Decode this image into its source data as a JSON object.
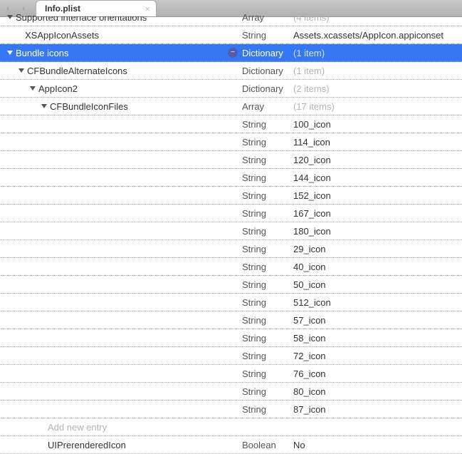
{
  "tab": {
    "title": "Info.plist"
  },
  "rows": [
    {
      "indent": 0,
      "disclosure": true,
      "key": "Supported interface orientations",
      "type": "Array",
      "value": "(4 items)",
      "valueDim": true,
      "selected": false,
      "cutTop": true
    },
    {
      "indent": 1,
      "disclosure": false,
      "key": "XSAppIconAssets",
      "type": "String",
      "value": "Assets.xcassets/AppIcon.appiconset",
      "valueDim": false,
      "selected": false
    },
    {
      "indent": 0,
      "disclosure": true,
      "key": "Bundle icons",
      "type": "Dictionary",
      "value": "(1 item)",
      "valueDim": true,
      "selected": true,
      "removeBadge": true
    },
    {
      "indent": 1,
      "disclosure": true,
      "key": "CFBundleAlternateIcons",
      "type": "Dictionary",
      "value": "(1 item)",
      "valueDim": true,
      "selected": false
    },
    {
      "indent": 2,
      "disclosure": true,
      "key": "AppIcon2",
      "type": "Dictionary",
      "value": "(2 items)",
      "valueDim": true,
      "selected": false
    },
    {
      "indent": 3,
      "disclosure": true,
      "key": "CFBundleIconFiles",
      "type": "Array",
      "value": "(17 items)",
      "valueDim": true,
      "selected": false
    },
    {
      "indent": 4,
      "disclosure": false,
      "key": "",
      "type": "String",
      "value": "100_icon",
      "valueDim": false,
      "selected": false
    },
    {
      "indent": 4,
      "disclosure": false,
      "key": "",
      "type": "String",
      "value": "114_icon",
      "valueDim": false,
      "selected": false
    },
    {
      "indent": 4,
      "disclosure": false,
      "key": "",
      "type": "String",
      "value": "120_icon",
      "valueDim": false,
      "selected": false
    },
    {
      "indent": 4,
      "disclosure": false,
      "key": "",
      "type": "String",
      "value": "144_icon",
      "valueDim": false,
      "selected": false
    },
    {
      "indent": 4,
      "disclosure": false,
      "key": "",
      "type": "String",
      "value": "152_icon",
      "valueDim": false,
      "selected": false
    },
    {
      "indent": 4,
      "disclosure": false,
      "key": "",
      "type": "String",
      "value": "167_icon",
      "valueDim": false,
      "selected": false
    },
    {
      "indent": 4,
      "disclosure": false,
      "key": "",
      "type": "String",
      "value": "180_icon",
      "valueDim": false,
      "selected": false
    },
    {
      "indent": 4,
      "disclosure": false,
      "key": "",
      "type": "String",
      "value": "29_icon",
      "valueDim": false,
      "selected": false
    },
    {
      "indent": 4,
      "disclosure": false,
      "key": "",
      "type": "String",
      "value": "40_icon",
      "valueDim": false,
      "selected": false
    },
    {
      "indent": 4,
      "disclosure": false,
      "key": "",
      "type": "String",
      "value": "50_icon",
      "valueDim": false,
      "selected": false
    },
    {
      "indent": 4,
      "disclosure": false,
      "key": "",
      "type": "String",
      "value": "512_icon",
      "valueDim": false,
      "selected": false
    },
    {
      "indent": 4,
      "disclosure": false,
      "key": "",
      "type": "String",
      "value": "57_icon",
      "valueDim": false,
      "selected": false
    },
    {
      "indent": 4,
      "disclosure": false,
      "key": "",
      "type": "String",
      "value": "58_icon",
      "valueDim": false,
      "selected": false
    },
    {
      "indent": 4,
      "disclosure": false,
      "key": "",
      "type": "String",
      "value": "72_icon",
      "valueDim": false,
      "selected": false
    },
    {
      "indent": 4,
      "disclosure": false,
      "key": "",
      "type": "String",
      "value": "76_icon",
      "valueDim": false,
      "selected": false
    },
    {
      "indent": 4,
      "disclosure": false,
      "key": "",
      "type": "String",
      "value": "80_icon",
      "valueDim": false,
      "selected": false
    },
    {
      "indent": 4,
      "disclosure": false,
      "key": "",
      "type": "String",
      "value": "87_icon",
      "valueDim": false,
      "selected": false
    },
    {
      "indent": 3,
      "disclosure": false,
      "key": "",
      "type": "",
      "value": "",
      "valueDim": false,
      "selected": false,
      "placeholderKey": "Add new entry"
    },
    {
      "indent": 3,
      "disclosure": false,
      "key": "UIPrerenderedIcon",
      "type": "Boolean",
      "value": "No",
      "valueDim": false,
      "selected": false
    }
  ]
}
